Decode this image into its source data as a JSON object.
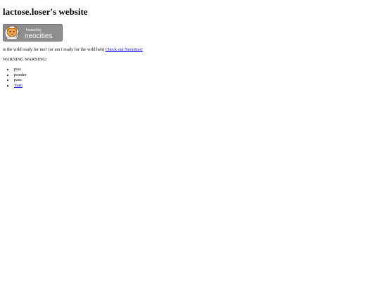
{
  "page": {
    "title": "lactose.loser's website"
  },
  "badge": {
    "line1": "hosted by",
    "line2": "neocities"
  },
  "intro": {
    "text": "is the wrld ready for me? (or am i ready for the wrld heh)",
    "link_label": "Check out Neocities!"
  },
  "warning": {
    "text": "WARNING WARNING!"
  },
  "list": {
    "items": [
      "piss",
      "ponder",
      "pass"
    ],
    "link_label": "Yarn"
  }
}
